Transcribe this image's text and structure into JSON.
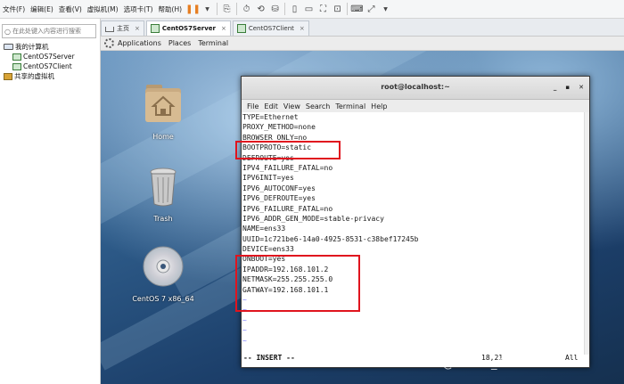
{
  "menubar": {
    "items": [
      "文件(F)",
      "编辑(E)",
      "查看(V)",
      "虚拟机(M)",
      "选项卡(T)",
      "帮助(H)"
    ]
  },
  "library": {
    "search_placeholder": "在此处键入内容进行搜索",
    "tree": [
      {
        "label": "我的计算机",
        "icon": "computer-icon",
        "indent": 0
      },
      {
        "label": "CentOS7Server",
        "icon": "vm-icon",
        "indent": 1
      },
      {
        "label": "CentOS7Client",
        "icon": "vm-icon",
        "indent": 1
      },
      {
        "label": "共享的虚拟机",
        "icon": "shared-folder-icon",
        "indent": 0
      }
    ]
  },
  "tabs": [
    {
      "label": "主页",
      "active": false
    },
    {
      "label": "CentOS7Server",
      "active": true
    },
    {
      "label": "CentOS7Client",
      "active": false
    }
  ],
  "gnome": {
    "applications": "Applications",
    "places": "Places",
    "terminal": "Terminal"
  },
  "desktop": {
    "home_label": "Home",
    "trash_label": "Trash",
    "cd_label": "CentOS 7 x86_64"
  },
  "terminal": {
    "title": "root@localhost:~",
    "menu": [
      "File",
      "Edit",
      "View",
      "Search",
      "Terminal",
      "Help"
    ],
    "lines": [
      "TYPE=Ethernet",
      "PROXY_METHOD=none",
      "BROWSER_ONLY=no",
      "BOOTPROTO=static",
      "DEFROUTE=yes",
      "IPV4_FAILURE_FATAL=no",
      "IPV6INIT=yes",
      "IPV6_AUTOCONF=yes",
      "IPV6_DEFROUTE=yes",
      "IPV6_FAILURE_FATAL=no",
      "IPV6_ADDR_GEN_MODE=stable-privacy",
      "NAME=ens33",
      "UUID=1c721be6-14a0-4925-8531-c38bef17245b",
      "DEVICE=ens33",
      "ONBOOT=yes",
      "IPADDR=192.168.101.2",
      "NETMASK=255.255.255.0",
      "GATWAY=192.168.101.1",
      "~",
      "~",
      "~",
      "~",
      "~"
    ],
    "status_mode": "-- INSERT --",
    "status_pos": "18,21",
    "status_all": "All"
  },
  "watermark": "CSDN @weixin_45784275",
  "colors": {
    "highlight": "#e0141e",
    "pause": "#e67e22"
  }
}
